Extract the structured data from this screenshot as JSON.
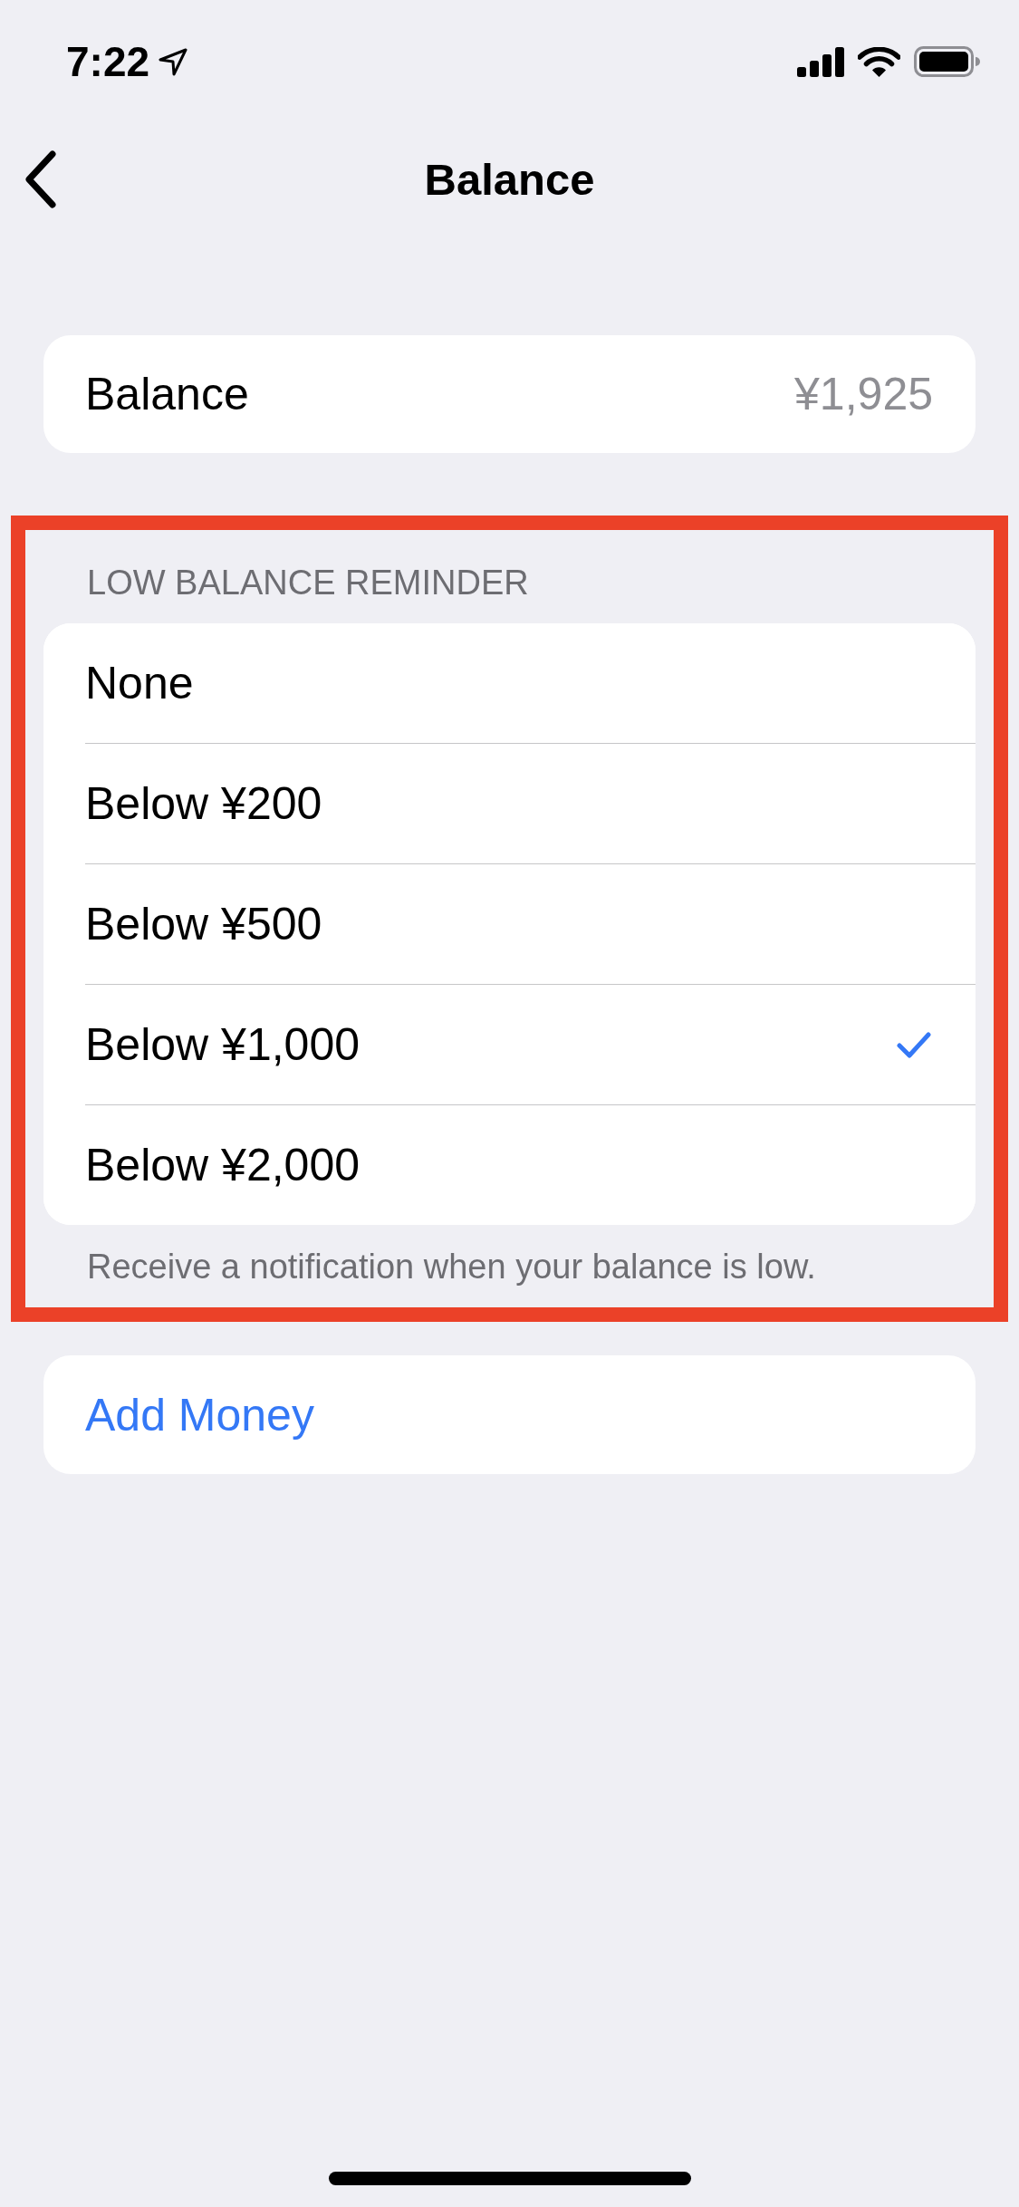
{
  "status_bar": {
    "time": "7:22"
  },
  "nav_bar": {
    "title": "Balance"
  },
  "balance_row": {
    "label": "Balance",
    "value": "¥1,925"
  },
  "reminder_section": {
    "highlighted": true,
    "header": "LOW BALANCE REMINDER",
    "options": [
      {
        "label": "None",
        "selected": false
      },
      {
        "label": "Below ¥200",
        "selected": false
      },
      {
        "label": "Below ¥500",
        "selected": false
      },
      {
        "label": "Below ¥1,000",
        "selected": true
      },
      {
        "label": "Below ¥2,000",
        "selected": false
      }
    ],
    "footer": "Receive a notification when your balance is low."
  },
  "add_money": {
    "label": "Add Money"
  }
}
